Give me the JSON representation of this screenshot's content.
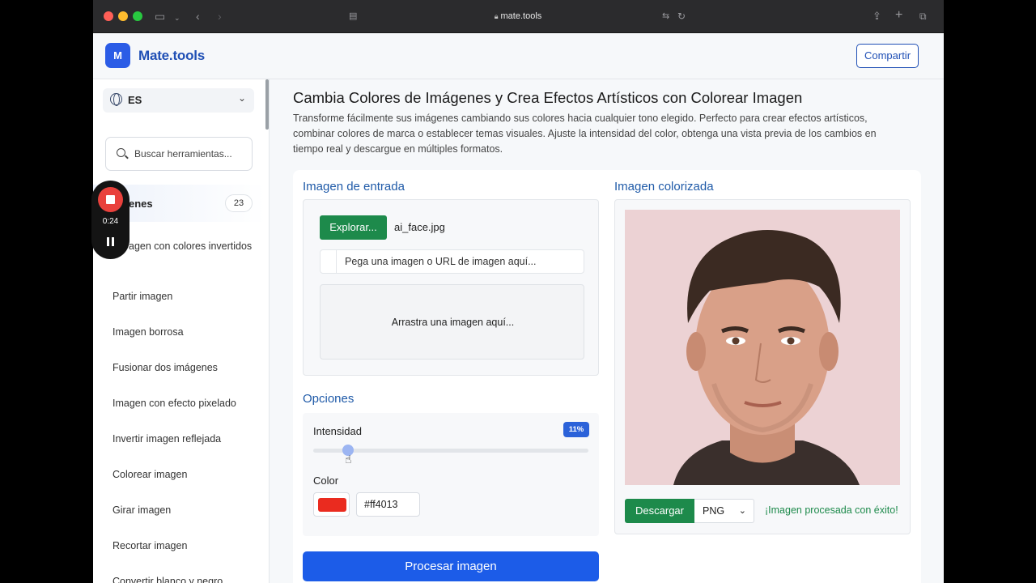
{
  "browser": {
    "url": "mate.tools"
  },
  "header": {
    "logo_letter": "M",
    "brand": "Mate.tools",
    "share_label": "Compartir"
  },
  "sidebar": {
    "language": "ES",
    "search_placeholder": "Buscar herramientas...",
    "category_label": "enes",
    "category_count": "23",
    "items": [
      {
        "label": "agen con colores invertidos"
      },
      {
        "label": "Partir imagen"
      },
      {
        "label": "Imagen borrosa"
      },
      {
        "label": "Fusionar dos imágenes"
      },
      {
        "label": "Imagen con efecto pixelado"
      },
      {
        "label": "Invertir imagen reflejada"
      },
      {
        "label": "Colorear imagen"
      },
      {
        "label": "Girar imagen"
      },
      {
        "label": "Recortar imagen"
      },
      {
        "label": "Convertir blanco y negro"
      }
    ]
  },
  "recording": {
    "time": "0:24"
  },
  "main": {
    "title": "Cambia Colores de Imágenes y Crea Efectos Artísticos con Colorear Imagen",
    "description": "Transforme fácilmente sus imágenes cambiando sus colores hacia cualquier tono elegido. Perfecto para crear efectos artísticos, combinar colores de marca o establecer temas visuales. Ajuste la intensidad del color, obtenga una vista previa de los cambios en tiempo real y descargue en múltiples formatos.",
    "input_title": "Imagen de entrada",
    "explore_label": "Explorar...",
    "file_name": "ai_face.jpg",
    "url_placeholder": "Pega una imagen o URL de imagen aquí...",
    "drop_text": "Arrastra una imagen aquí...",
    "options_title": "Opciones",
    "intensity_label": "Intensidad",
    "intensity_badge": "11%",
    "intensity_value": 0.11,
    "color_label": "Color",
    "color_hex": "#ff4013",
    "process_label": "Procesar imagen",
    "output_title": "Imagen colorizada",
    "download_label": "Descargar",
    "format_value": "PNG",
    "success_text": "¡Imagen procesada con éxito!"
  },
  "colors": {
    "brand": "#2b5ce6",
    "green": "#1d8a4b",
    "process_blue": "#1c5ce8",
    "swatch": "#ea2b1f"
  }
}
